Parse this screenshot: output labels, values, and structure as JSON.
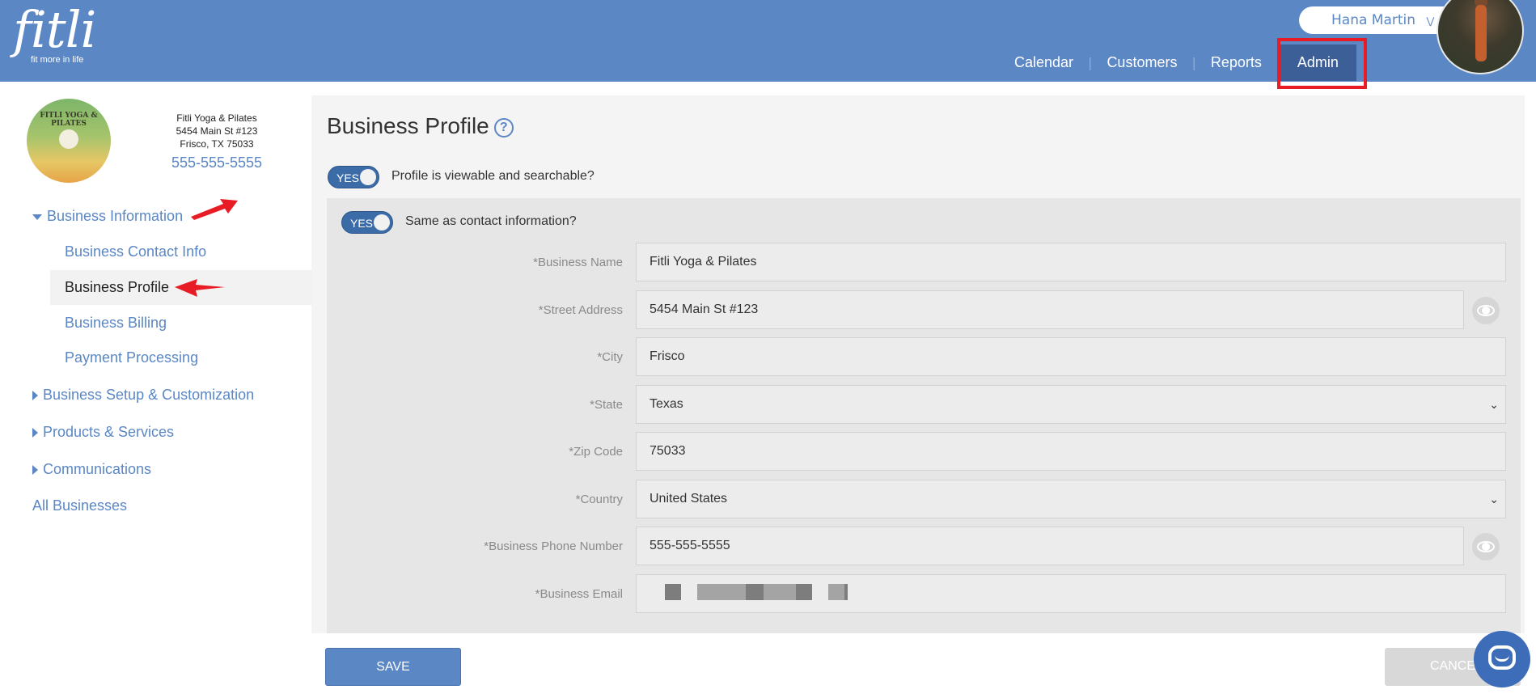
{
  "header": {
    "logo_text": "fitli",
    "logo_tagline": "fit more in life",
    "user_name": "Hana Martin",
    "nav": [
      {
        "label": "Calendar"
      },
      {
        "label": "Customers"
      },
      {
        "label": "Reports"
      },
      {
        "label": "Admin",
        "active": true
      }
    ],
    "nav_separator": "|"
  },
  "business": {
    "logo_text": "FITLI YOGA & PILATES",
    "name": "Fitli Yoga & Pilates",
    "address": "5454 Main St #123",
    "city_state_zip": "Frisco, TX 75033",
    "phone": "555-555-5555"
  },
  "sidebar": {
    "business_information": "Business Information",
    "sub_items": [
      {
        "label": "Business Contact Info"
      },
      {
        "label": "Business Profile",
        "active": true
      },
      {
        "label": "Business Billing"
      },
      {
        "label": "Payment Processing"
      }
    ],
    "business_setup": "Business Setup & Customization",
    "products_services": "Products & Services",
    "communications": "Communications",
    "all_businesses": "All Businesses"
  },
  "main": {
    "title": "Business Profile",
    "help_glyph": "?",
    "profile_toggle": {
      "state": "YES",
      "label": "Profile is viewable and searchable?"
    },
    "contact_toggle": {
      "state": "YES",
      "label": "Same as contact information?"
    },
    "fields": {
      "business_name": {
        "label": "*Business Name",
        "value": "Fitli Yoga & Pilates"
      },
      "street_address": {
        "label": "*Street Address",
        "value": "5454 Main St #123"
      },
      "city": {
        "label": "*City",
        "value": "Frisco"
      },
      "state": {
        "label": "*State",
        "value": "Texas"
      },
      "zip": {
        "label": "*Zip Code",
        "value": "75033"
      },
      "country": {
        "label": "*Country",
        "value": "United States"
      },
      "phone": {
        "label": "*Business Phone Number",
        "value": "555-555-5555"
      },
      "email": {
        "label": "*Business Email",
        "value": ""
      }
    }
  },
  "footer": {
    "save_label": "SAVE",
    "cancel_label": "CANCEL"
  },
  "colors": {
    "brand_blue": "#5b87c5",
    "nav_active": "#3b5f96",
    "annotation_red": "#e81c24"
  }
}
